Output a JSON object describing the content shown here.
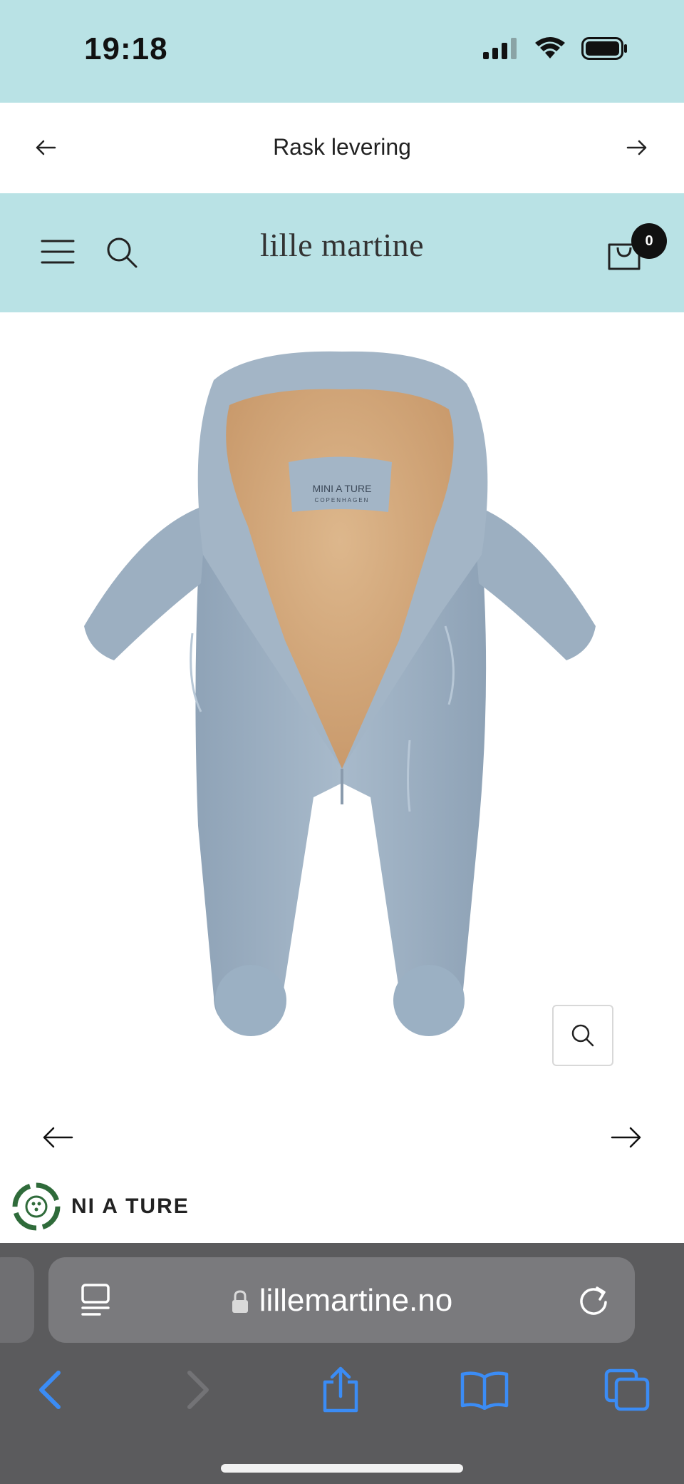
{
  "status_bar": {
    "time": "19:18"
  },
  "announcement": {
    "text": "Rask levering"
  },
  "header": {
    "logo": "lille martine",
    "cart_count": "0"
  },
  "product": {
    "brand": "NI A TURE",
    "label_line1": "MINI A TURE",
    "label_line2": "COPENHAGEN"
  },
  "browser": {
    "url": "lillemartine.no"
  },
  "colors": {
    "header_bg": "#b9e2e5",
    "safari_bg": "#5b5b5d",
    "ios_blue": "#3b8cf5",
    "suit_blue": "#9eb1c4",
    "fleece": "#d6ae82"
  },
  "icons": [
    "signal-icon",
    "wifi-icon",
    "battery-icon",
    "arrow-left-icon",
    "arrow-right-icon",
    "menu-icon",
    "search-icon",
    "cart-icon",
    "zoom-icon",
    "brand-logo-icon",
    "lock-icon",
    "reader-icon",
    "reload-icon",
    "back-icon",
    "forward-icon",
    "share-icon",
    "bookmarks-icon",
    "tabs-icon"
  ]
}
